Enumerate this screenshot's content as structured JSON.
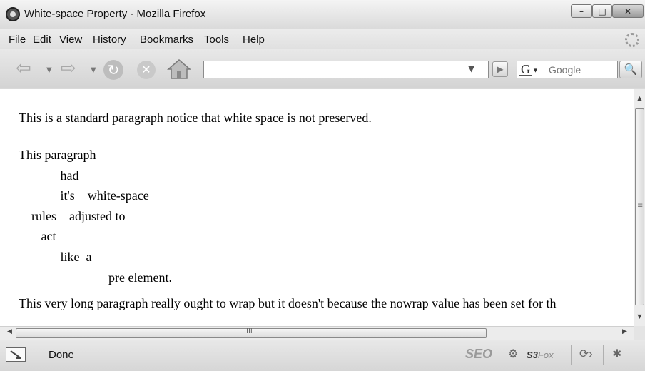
{
  "window": {
    "title": "White-space Property - Mozilla Firefox",
    "controls": {
      "minimize": "–",
      "maximize": "□",
      "close": "✕"
    }
  },
  "menu": {
    "items": [
      {
        "label": "File",
        "access_key": "F"
      },
      {
        "label": "Edit",
        "access_key": "E"
      },
      {
        "label": "View",
        "access_key": "V"
      },
      {
        "label": "History",
        "access_key": "s"
      },
      {
        "label": "Bookmarks",
        "access_key": "B"
      },
      {
        "label": "Tools",
        "access_key": "T"
      },
      {
        "label": "Help",
        "access_key": "H"
      }
    ]
  },
  "toolbar": {
    "back_icon": "back-arrow-icon",
    "forward_icon": "forward-arrow-icon",
    "reload_icon": "reload-icon",
    "stop_icon": "stop-icon",
    "home_icon": "home-icon",
    "url_value": "",
    "search_engine": "G",
    "search_placeholder": "Google"
  },
  "content": {
    "paragraph1": "This is a standard paragraph notice that white space is not preserved.",
    "paragraph2": "This paragraph\n             had\n             it's    white-space\n    rules    adjusted to\n       act\n             like  a\n                            pre element.",
    "paragraph3": "This very long paragraph really ought to wrap but it doesn't because the nowrap value has been set for th"
  },
  "status": {
    "text": "Done",
    "seo_label": "SEO",
    "s3fox_label": "S3",
    "s3fox_suffix": "Fox"
  },
  "colors": {
    "chrome_bg": "#d9d9d9",
    "content_bg": "#ffffff",
    "text": "#000000"
  }
}
